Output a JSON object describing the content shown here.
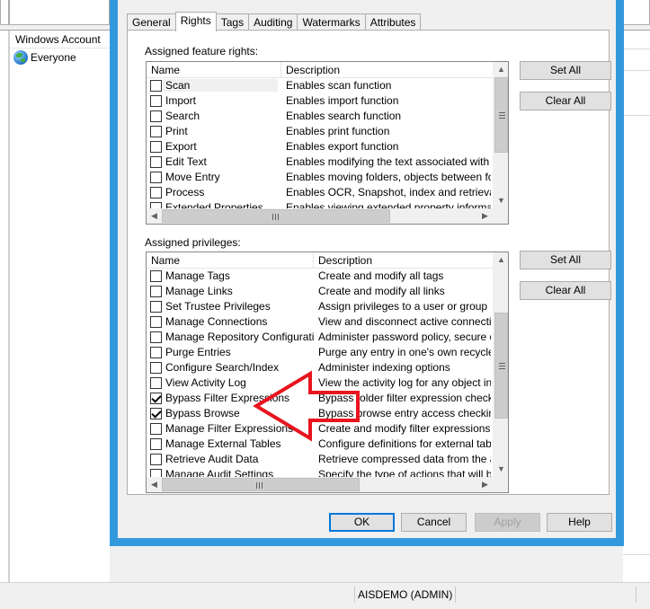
{
  "background": {
    "accounts_header": "Windows Account",
    "accounts": [
      {
        "name": "Everyone",
        "icon": "globe-icon"
      }
    ],
    "status_user": "AISDEMO (ADMIN)"
  },
  "dialog": {
    "tabs": [
      {
        "label": "General",
        "active": false
      },
      {
        "label": "Rights",
        "active": true
      },
      {
        "label": "Tags",
        "active": false
      },
      {
        "label": "Auditing",
        "active": false
      },
      {
        "label": "Watermarks",
        "active": false
      },
      {
        "label": "Attributes",
        "active": false
      }
    ],
    "feature_rights": {
      "label": "Assigned feature rights:",
      "columns": [
        "Name",
        "Description"
      ],
      "rows": [
        {
          "name": "Scan",
          "desc": "Enables scan function",
          "checked": false
        },
        {
          "name": "Import",
          "desc": "Enables import function",
          "checked": false
        },
        {
          "name": "Search",
          "desc": "Enables search function",
          "checked": false
        },
        {
          "name": "Print",
          "desc": "Enables print function",
          "checked": false
        },
        {
          "name": "Export",
          "desc": "Enables export function",
          "checked": false
        },
        {
          "name": "Edit Text",
          "desc": "Enables modifying the text associated with a document",
          "checked": false
        },
        {
          "name": "Move Entry",
          "desc": "Enables moving folders, objects between folders",
          "checked": false
        },
        {
          "name": "Process",
          "desc": "Enables OCR, Snapshot, index and retrieval of text",
          "checked": false
        },
        {
          "name": "Extended Properties",
          "desc": "Enables viewing extended property information",
          "checked": false
        }
      ],
      "set_all": "Set All",
      "clear_all": "Clear All"
    },
    "privileges": {
      "label": "Assigned privileges:",
      "columns": [
        "Name",
        "Description"
      ],
      "rows": [
        {
          "name": "Manage Tags",
          "desc": "Create and modify all tags",
          "checked": false
        },
        {
          "name": "Manage Links",
          "desc": "Create and modify all links",
          "checked": false
        },
        {
          "name": "Set Trustee Privileges",
          "desc": "Assign privileges to a user or group",
          "checked": false
        },
        {
          "name": "Manage Connections",
          "desc": "View and disconnect active connections",
          "checked": false
        },
        {
          "name": "Manage Repository Configuration",
          "desc": "Administer password policy, secure deletion",
          "checked": false
        },
        {
          "name": "Purge Entries",
          "desc": "Purge any entry in one's own recycle bin",
          "checked": false
        },
        {
          "name": "Configure Search/Index",
          "desc": "Administer indexing options",
          "checked": false
        },
        {
          "name": "View Activity Log",
          "desc": "View the activity log for any object in the",
          "checked": false
        },
        {
          "name": "Bypass Filter Expressions",
          "desc": "Bypass folder filter expression checking when",
          "checked": true
        },
        {
          "name": "Bypass Browse",
          "desc": "Bypass browse entry access checking when",
          "checked": true
        },
        {
          "name": "Manage Filter Expressions",
          "desc": "Create and modify filter expressions",
          "checked": false
        },
        {
          "name": "Manage External Tables",
          "desc": "Configure definitions for external tables",
          "checked": false
        },
        {
          "name": "Retrieve Audit Data",
          "desc": "Retrieve compressed data from the audit",
          "checked": false
        },
        {
          "name": "Manage Audit Settings",
          "desc": "Specify the type of actions that will be audited",
          "checked": false
        }
      ],
      "set_all": "Set All",
      "clear_all": "Clear All"
    },
    "buttons": {
      "ok": "OK",
      "cancel": "Cancel",
      "apply": "Apply",
      "help": "Help"
    },
    "annotation_color": "#e8141e"
  }
}
